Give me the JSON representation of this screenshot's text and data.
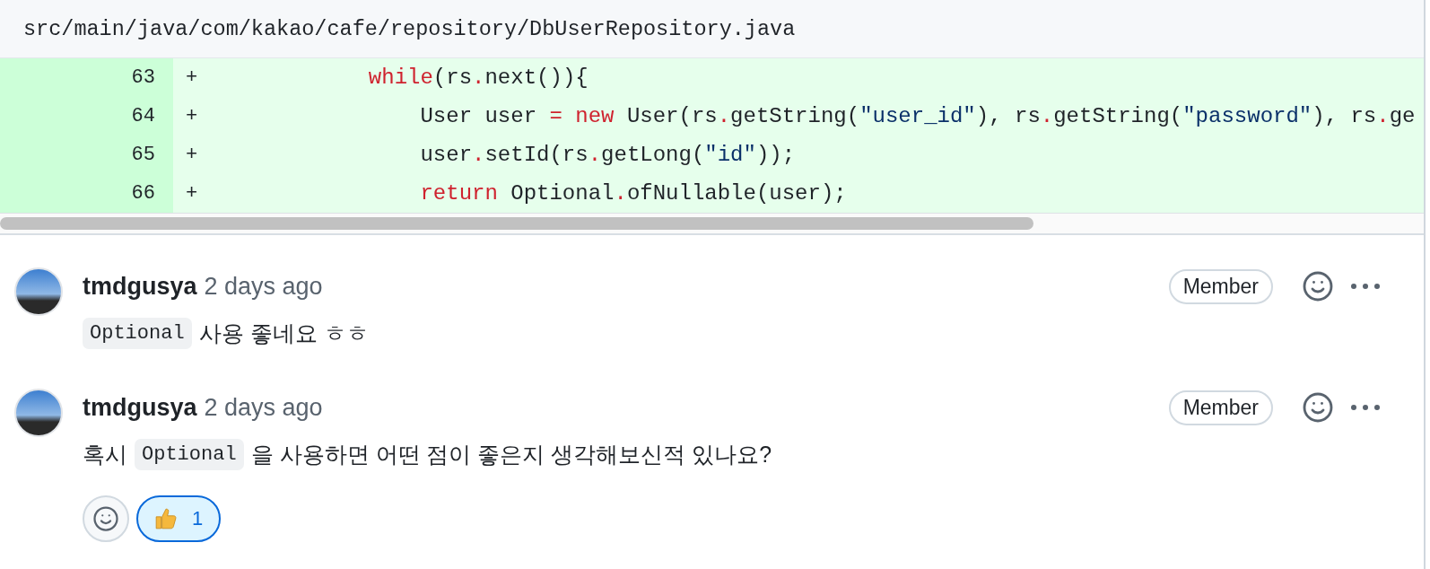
{
  "file": {
    "path": "src/main/java/com/kakao/cafe/repository/DbUserRepository.java"
  },
  "diff_lines": [
    {
      "number": "63",
      "sign": "+",
      "tokens": [
        {
          "kind": "keyword",
          "text": "            while"
        },
        {
          "kind": "plain",
          "text": "(rs"
        },
        {
          "kind": "operator",
          "text": "."
        },
        {
          "kind": "plain",
          "text": "next()){"
        }
      ]
    },
    {
      "number": "64",
      "sign": "+",
      "tokens": [
        {
          "kind": "plain",
          "text": "                User user "
        },
        {
          "kind": "operator",
          "text": "="
        },
        {
          "kind": "keyword",
          "text": " new"
        },
        {
          "kind": "plain",
          "text": " User(rs"
        },
        {
          "kind": "operator",
          "text": "."
        },
        {
          "kind": "plain",
          "text": "getString("
        },
        {
          "kind": "string",
          "text": "\"user_id\""
        },
        {
          "kind": "plain",
          "text": "), rs"
        },
        {
          "kind": "operator",
          "text": "."
        },
        {
          "kind": "plain",
          "text": "getString("
        },
        {
          "kind": "string",
          "text": "\"password\""
        },
        {
          "kind": "plain",
          "text": "), rs"
        },
        {
          "kind": "operator",
          "text": "."
        },
        {
          "kind": "plain",
          "text": "ge"
        }
      ]
    },
    {
      "number": "65",
      "sign": "+",
      "tokens": [
        {
          "kind": "plain",
          "text": "                user"
        },
        {
          "kind": "operator",
          "text": "."
        },
        {
          "kind": "plain",
          "text": "setId(rs"
        },
        {
          "kind": "operator",
          "text": "."
        },
        {
          "kind": "plain",
          "text": "getLong("
        },
        {
          "kind": "string",
          "text": "\"id\""
        },
        {
          "kind": "plain",
          "text": "));"
        }
      ]
    },
    {
      "number": "66",
      "sign": "+",
      "tokens": [
        {
          "kind": "keyword",
          "text": "                return"
        },
        {
          "kind": "plain",
          "text": " Optional"
        },
        {
          "kind": "operator",
          "text": "."
        },
        {
          "kind": "plain",
          "text": "ofNullable(user);"
        }
      ]
    }
  ],
  "comments": [
    {
      "author": "tmdgusya",
      "time": "2 days ago",
      "role": "Member",
      "body": [
        {
          "kind": "code",
          "text": "Optional"
        },
        {
          "kind": "text",
          "text": "사용 좋네요 ㅎㅎ"
        }
      ]
    },
    {
      "author": "tmdgusya",
      "time": "2 days ago",
      "role": "Member",
      "body": [
        {
          "kind": "text",
          "text": "혹시"
        },
        {
          "kind": "code",
          "text": "Optional"
        },
        {
          "kind": "text",
          "text": "을 사용하면 어떤 점이 좋은지 생각해보신적 있나요?"
        }
      ],
      "reactions": [
        {
          "kind": "add"
        },
        {
          "kind": "thumbs-up",
          "count": "1",
          "selected": true
        }
      ]
    }
  ]
}
